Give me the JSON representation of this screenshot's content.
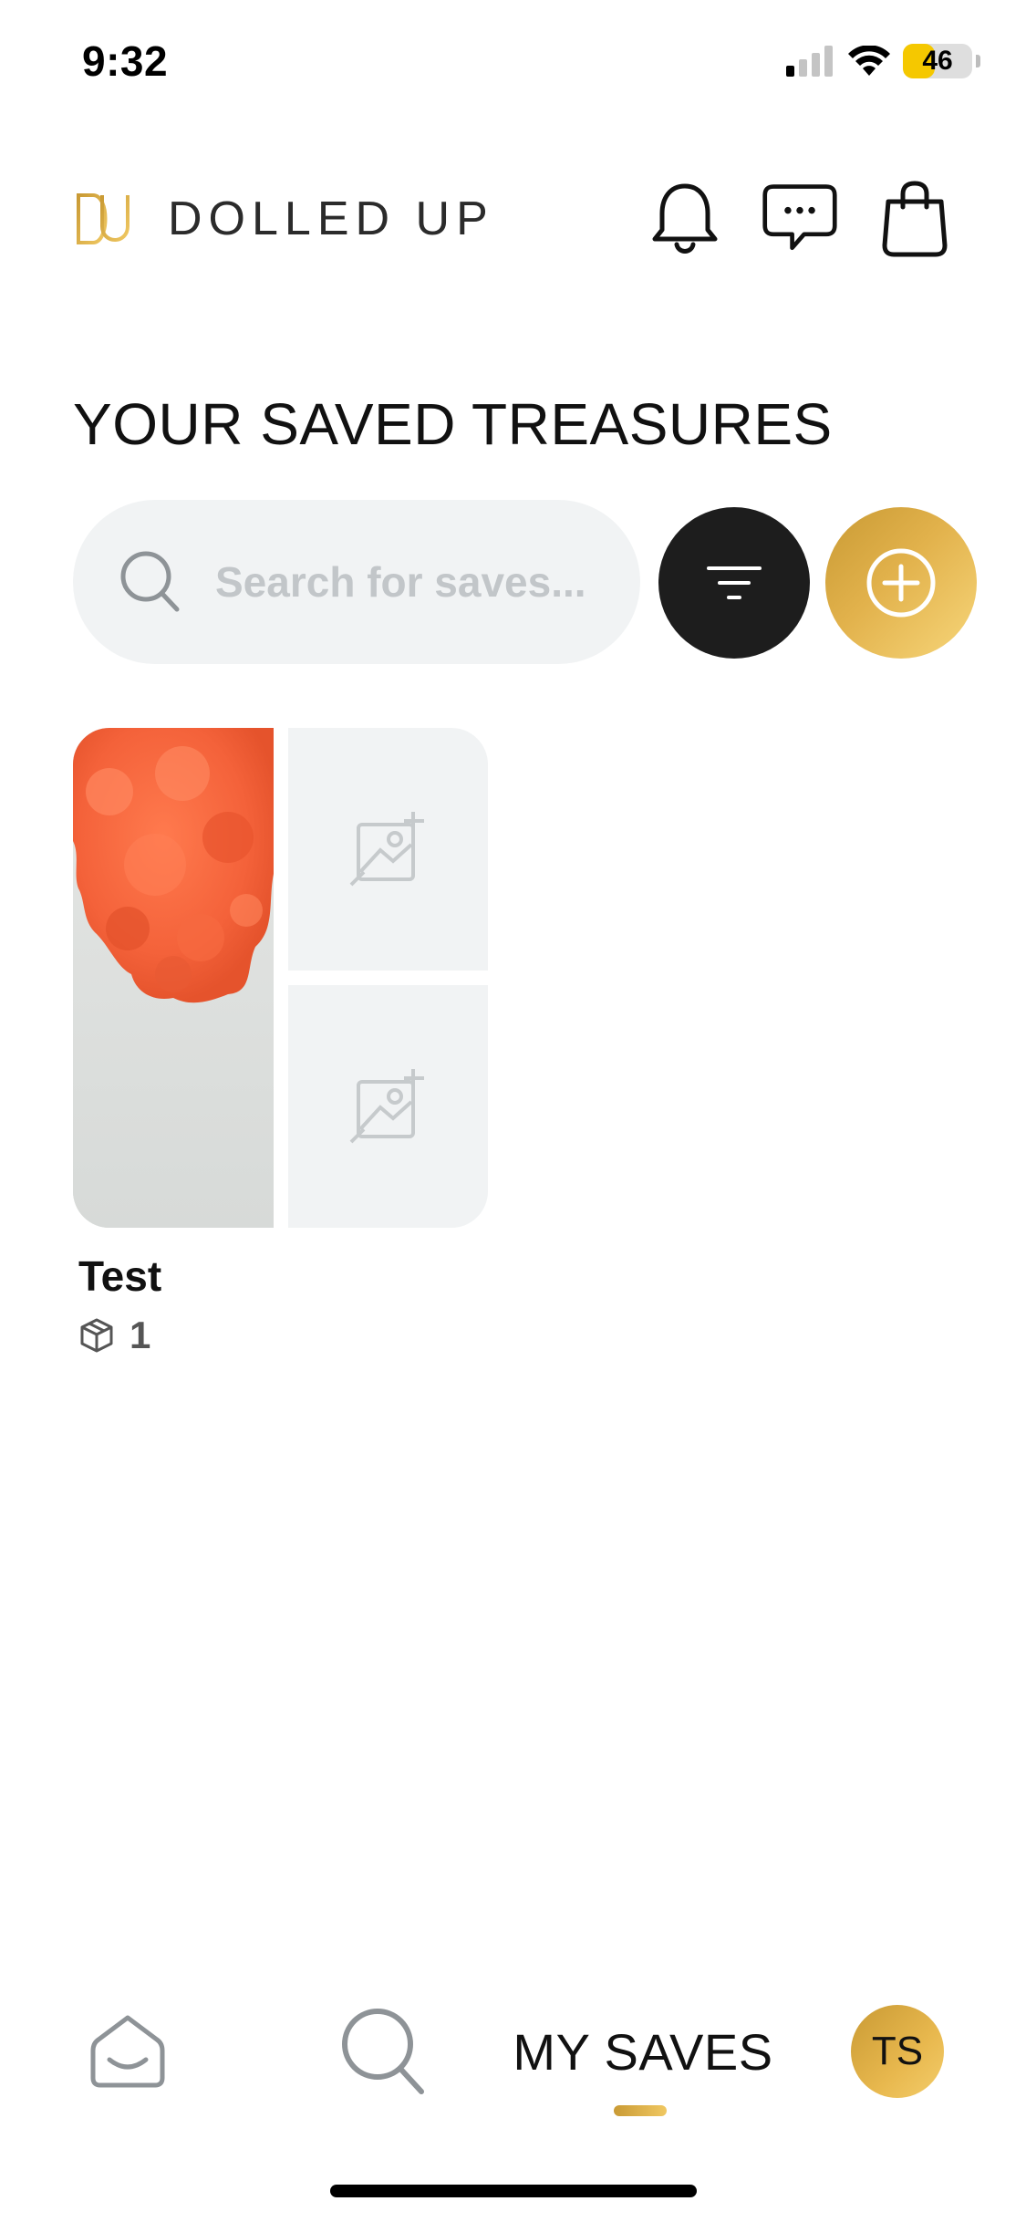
{
  "status_bar": {
    "time": "9:32",
    "battery_level": "46",
    "icons": [
      "cellular-signal-icon",
      "wifi-icon",
      "battery-icon"
    ]
  },
  "header": {
    "brand_name": "DOLLED UP",
    "actions": [
      "bell-icon",
      "chat-icon",
      "shopping-bag-icon"
    ]
  },
  "page": {
    "title": "YOUR SAVED TREASURES"
  },
  "search": {
    "value": "",
    "placeholder": "Search for saves..."
  },
  "collections": [
    {
      "name": "Test",
      "count": "1"
    }
  ],
  "bottom_nav": {
    "active_label": "MY SAVES",
    "avatar_initials": "TS",
    "items": [
      "home-icon",
      "search-icon",
      "my-saves",
      "profile-avatar"
    ]
  },
  "colors": {
    "accent_gold": "#e2b24c",
    "dark_button": "#1d1d1d",
    "field_bg": "#f1f3f4",
    "battery_yellow": "#f5c800"
  }
}
